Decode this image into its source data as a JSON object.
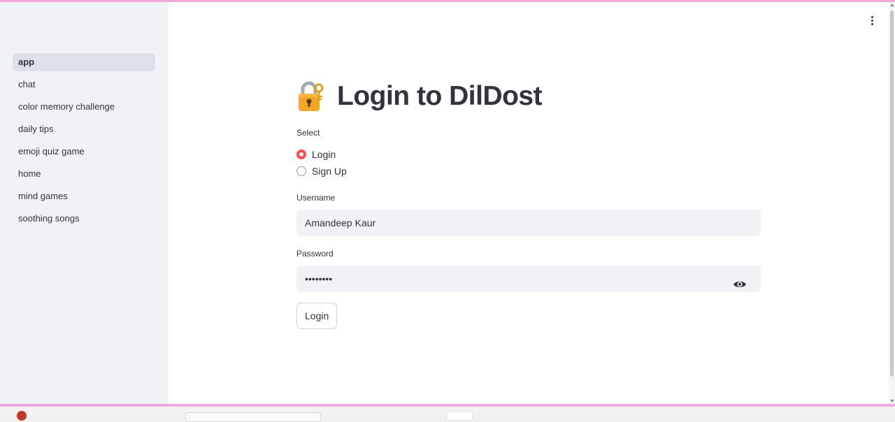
{
  "sidebar": {
    "items": [
      {
        "label": "app",
        "active": true
      },
      {
        "label": "chat"
      },
      {
        "label": "color memory challenge"
      },
      {
        "label": "daily tips"
      },
      {
        "label": "emoji quiz game"
      },
      {
        "label": "home"
      },
      {
        "label": "mind games"
      },
      {
        "label": "soothing songs"
      }
    ]
  },
  "main": {
    "title_icon": "locked-with-key-icon",
    "title": "Login to DilDost",
    "select_label": "Select",
    "radio_options": [
      {
        "label": "Login",
        "checked": true
      },
      {
        "label": "Sign Up",
        "checked": false
      }
    ],
    "username": {
      "label": "Username",
      "value": "Amandeep Kaur"
    },
    "password": {
      "label": "Password",
      "value": "••••••••",
      "toggle_icon": "eye-icon"
    },
    "login_button": "Login"
  },
  "colors": {
    "accent": "#ff4b4b",
    "sidebar_bg": "#f0f2f6",
    "input_bg": "#f0f2f6",
    "text": "#31333f"
  }
}
